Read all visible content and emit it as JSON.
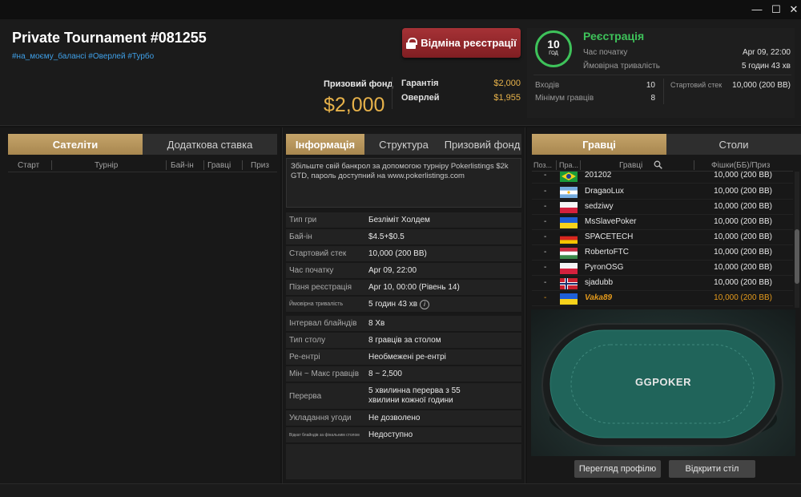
{
  "window": {
    "minimize": "—",
    "maximize": "☐",
    "close": "✕"
  },
  "tournament": {
    "title": "Private Tournament #081255",
    "tags": "#на_моєму_балансі #Оверлей #Турбо",
    "cancel_label": "Відміна реєстрації",
    "prize_fund_label": "Призовий фонд",
    "prize_fund_value": "$2,000",
    "guarantee_label": "Гарантія",
    "guarantee_value": "$2,000",
    "overlay_label": "Оверлей",
    "overlay_value": "$1,955"
  },
  "registration": {
    "clock_value": "10",
    "clock_unit": "ГОД",
    "status": "Реєстрація",
    "start_label": "Час початку",
    "start_value": "Apr 09, 22:00",
    "duration_label": "Ймовірна тривалість",
    "duration_value": "5 годин 43 хв",
    "entries_label": "Входів",
    "entries_value": "10",
    "min_players_label": "Мінімум гравців",
    "min_players_value": "8",
    "stack_label": "Стартовий стек",
    "stack_value": "10,000 (200 BB)"
  },
  "left_panel": {
    "tabs": [
      "Сателіти",
      "Додаткова ставка"
    ],
    "columns": [
      "Старт",
      "Турнір",
      "Бай-ін",
      "Гравці",
      "Приз"
    ]
  },
  "info_panel": {
    "tabs": [
      "Інформація",
      "Структура",
      "Призовий фонд"
    ],
    "description": "Збільште свій банкрол за допомогою турніру Pokerlistings $2k GTD, пароль доступний на www.pokerlistings.com",
    "rows": [
      {
        "k": "Тип гри",
        "v": "Безліміт Холдем"
      },
      {
        "k": "Бай-ін",
        "v": "$4.5+$0.5"
      },
      {
        "k": "Стартовий стек",
        "v": "10,000 (200 BB)"
      },
      {
        "k": "Час початку",
        "v": "Apr 09, 22:00"
      },
      {
        "k": "Пізня реєстрація",
        "v": "Apr 10, 00:00 (Рівень 14)"
      },
      {
        "k": "Ймовірна тривалість",
        "v": "5 годин 43 хв"
      },
      {
        "k": "Інтервал блайндів",
        "v": "8 Хв"
      },
      {
        "k": "Тип столу",
        "v": "8 гравців за столом"
      },
      {
        "k": "Ре-ентрі",
        "v": "Необмежені ре-ентрі"
      },
      {
        "k": "Мін ~ Макс гравців",
        "v": "8 ~ 2,500"
      },
      {
        "k": "Перерва",
        "v": "5 хвилинна перерва з 55 хвилини кожної години"
      },
      {
        "k": "Укладання угоди",
        "v": "Не дозволено"
      },
      {
        "k": "Відкат блайндів за фінальним столом",
        "v": "Недоступно"
      }
    ]
  },
  "players_panel": {
    "tabs": [
      "Гравці",
      "Столи"
    ],
    "columns": [
      "Поз...",
      "Пра...",
      "Гравці",
      "Фішки(ББ)/Приз"
    ],
    "players": [
      {
        "pos": "-",
        "name": "201202",
        "chips": "10,000 (200 BB)",
        "flag": "brazil-flag"
      },
      {
        "pos": "-",
        "name": "DragaoLux",
        "chips": "10,000 (200 BB)",
        "flag": "argentina-flag"
      },
      {
        "pos": "-",
        "name": "sedziwy",
        "chips": "10,000 (200 BB)",
        "flag": "poland-flag"
      },
      {
        "pos": "-",
        "name": "MsSlavePoker",
        "chips": "10,000 (200 BB)",
        "flag": "ukraine-flag"
      },
      {
        "pos": "-",
        "name": "SPACETECH",
        "chips": "10,000 (200 BB)",
        "flag": "germany-flag"
      },
      {
        "pos": "-",
        "name": "RobertoFTC",
        "chips": "10,000 (200 BB)",
        "flag": "hungary-flag"
      },
      {
        "pos": "-",
        "name": "PyronOSG",
        "chips": "10,000 (200 BB)",
        "flag": "poland-flag"
      },
      {
        "pos": "-",
        "name": "sjadubb",
        "chips": "10,000 (200 BB)",
        "flag": "norway-flag"
      },
      {
        "pos": "-",
        "name": "Vaka89",
        "chips": "10,000 (200 BB)",
        "flag": "ukraine-flag"
      }
    ],
    "table_logo": "GGPOKER",
    "view_profile": "Перегляд профілю",
    "open_table": "Відкрити стіл"
  },
  "colors": {
    "accent_gold": "#e7b24a",
    "green": "#3ec25a",
    "cancel_red": "#a63236",
    "highlight": "#e49a1c",
    "tab_gold": "#c5a46a"
  }
}
